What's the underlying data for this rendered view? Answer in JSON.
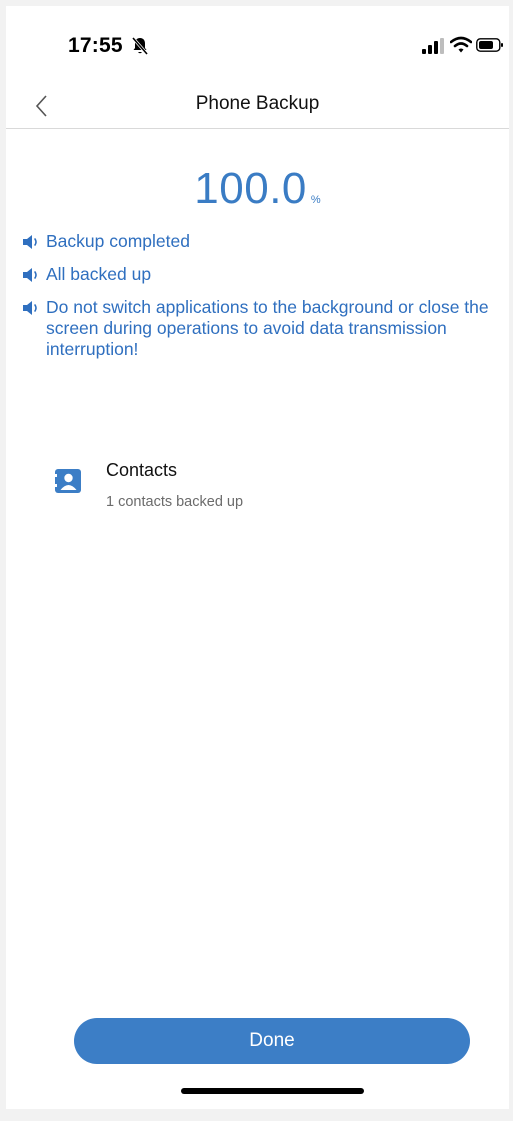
{
  "status_bar": {
    "time": "17:55",
    "icons": [
      "bell-slash-icon",
      "signal-icon",
      "wifi-icon",
      "battery-icon"
    ]
  },
  "nav": {
    "back_icon": "chevron-left-icon",
    "title": "Phone Backup"
  },
  "progress": {
    "value": "100.0",
    "unit": "%"
  },
  "messages": [
    {
      "icon": "speaker-icon",
      "text": "Backup completed"
    },
    {
      "icon": "speaker-icon",
      "text": "All backed up"
    },
    {
      "icon": "speaker-icon",
      "text": "Do not switch applications to the background or close the screen during operations to avoid data transmission interruption!"
    }
  ],
  "items": [
    {
      "icon": "contact-card-icon",
      "title": "Contacts",
      "subtitle": "1 contacts backed up"
    }
  ],
  "done_button": {
    "label": "Done"
  },
  "colors": {
    "accent": "#3c7ec6",
    "message_text": "#2f6fbf",
    "background": "#ffffff"
  }
}
